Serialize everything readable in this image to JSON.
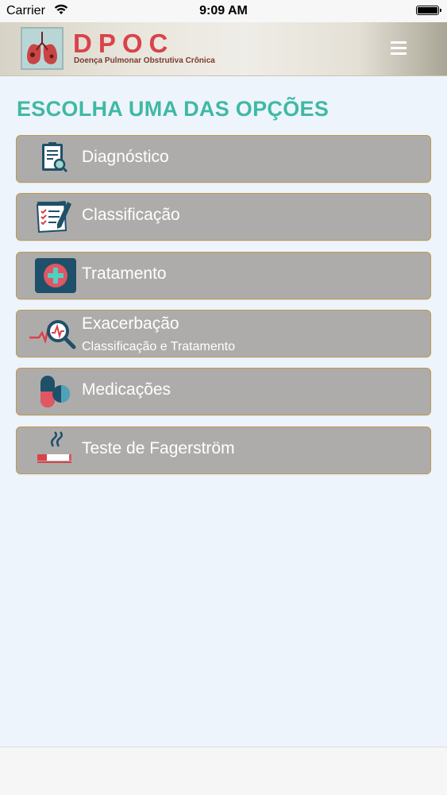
{
  "status_bar": {
    "carrier": "Carrier",
    "time": "9:09 AM"
  },
  "header": {
    "logo_icon": "lungs-icon",
    "title": "DPOC",
    "subtitle": "Doença Pulmonar Obstrutiva Crônica",
    "menu_icon": "hamburger-menu-icon"
  },
  "main": {
    "title": "ESCOLHA UMA DAS OPÇÕES",
    "options": [
      {
        "label": "Diagnóstico",
        "icon": "clipboard-search-icon"
      },
      {
        "label": "Classificação",
        "icon": "checklist-pencil-icon"
      },
      {
        "label": "Tratamento",
        "icon": "medical-cross-icon"
      },
      {
        "label": "Exacerbação",
        "sublabel": "Classificação e Tratamento",
        "icon": "pulse-magnifier-icon"
      },
      {
        "label": "Medicações",
        "icon": "pills-icon"
      },
      {
        "label": "Teste de Fagerström",
        "icon": "cigarette-icon"
      }
    ]
  },
  "colors": {
    "accent": "#3fb9a4",
    "brand": "#d9434a",
    "button_bg": "#aeacab",
    "button_border": "#bb9a4f"
  }
}
